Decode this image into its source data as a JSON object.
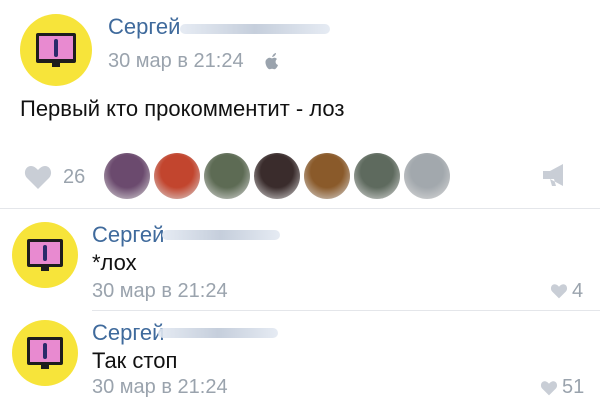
{
  "post": {
    "author": "Сергей",
    "time": "30 мар в 21:24",
    "device_icon": "apple-icon",
    "text": "Первый кто прокомментит - лоз",
    "likes_count": "26",
    "liker_colors": [
      "#6b4a6e",
      "#c2452e",
      "#5d6b54",
      "#3a2c2c",
      "#8a5a2a",
      "#5e6a5e",
      "#a2a8ad"
    ]
  },
  "comments": [
    {
      "author": "Сергей",
      "text": "*лох",
      "time": "30 мар в 21:24",
      "likes": "4"
    },
    {
      "author": "Сергей",
      "text": "Так стоп",
      "time": "30 мар в 21:24",
      "likes": "51"
    }
  ],
  "colors": {
    "name": "#3f6a9c",
    "meta": "#9aa3ad",
    "avatar_bg": "#f7e43a"
  }
}
